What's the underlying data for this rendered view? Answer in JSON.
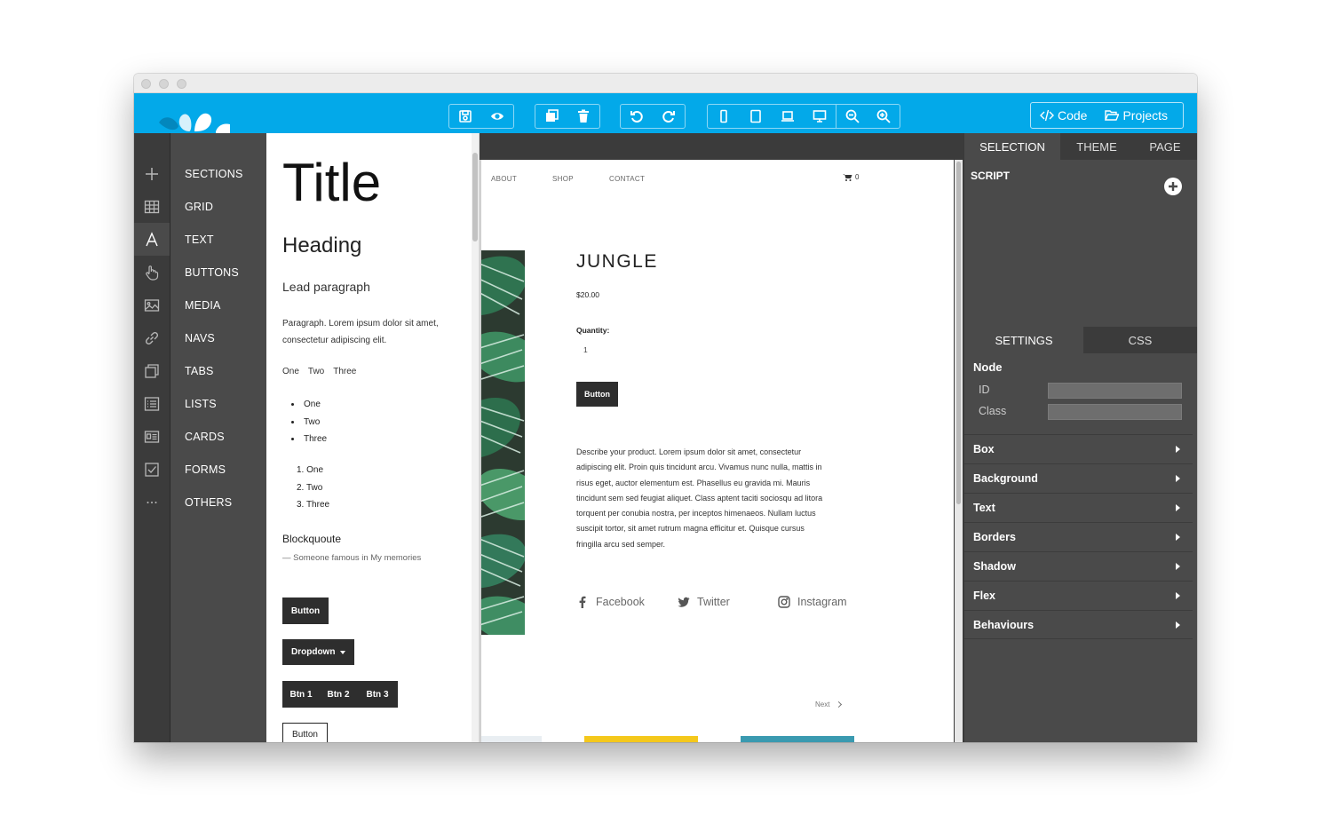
{
  "toolbar": {
    "code_label": "Code",
    "projects_label": "Projects"
  },
  "sidebar": {
    "items": [
      {
        "label": "SECTIONS",
        "icon": "plus-icon"
      },
      {
        "label": "GRID",
        "icon": "grid-icon"
      },
      {
        "label": "TEXT",
        "icon": "text-a-icon"
      },
      {
        "label": "BUTTONS",
        "icon": "pointer-hand-icon"
      },
      {
        "label": "MEDIA",
        "icon": "image-icon"
      },
      {
        "label": "NAVS",
        "icon": "link-icon"
      },
      {
        "label": "TABS",
        "icon": "tabs-icon"
      },
      {
        "label": "LISTS",
        "icon": "list-icon"
      },
      {
        "label": "CARDS",
        "icon": "card-icon"
      },
      {
        "label": "FORMS",
        "icon": "checkbox-icon"
      },
      {
        "label": "OTHERS",
        "icon": "ellipsis-icon"
      }
    ]
  },
  "blocks": {
    "title": "Title",
    "heading": "Heading",
    "lead": "Lead paragraph",
    "paragraph": "Paragraph. Lorem ipsum dolor sit amet, consectetur adipiscing elit.",
    "inline": [
      "One",
      "Two",
      "Three"
    ],
    "ulist": [
      "One",
      "Two",
      "Three"
    ],
    "olist": [
      "1. One",
      "2. Two",
      "3. Three"
    ],
    "blockquote": "Blockquoute",
    "blockquote_footer": "— Someone famous in My memories",
    "button": "Button",
    "dropdown": "Dropdown",
    "btn_group": [
      "Btn 1",
      "Btn 2",
      "Btn 3"
    ],
    "outline_button": "Button"
  },
  "canvas": {
    "nav": [
      "ABOUT",
      "SHOP",
      "CONTACT"
    ],
    "cart_count": "0",
    "product_title": "JUNGLE",
    "price": "$20.00",
    "quantity_label": "Quantity:",
    "quantity_value": "1",
    "button": "Button",
    "description": "Describe your product. Lorem ipsum dolor sit amet, consectetur adipiscing elit. Proin quis tincidunt arcu. Vivamus nunc nulla, mattis in risus eget, auctor elementum est. Phasellus eu gravida mi. Mauris tincidunt sem sed feugiat aliquet. Class aptent taciti sociosqu ad litora torquent per conubia nostra, per inceptos himenaeos. Nullam luctus suscipit tortor, sit amet rutrum magna efficitur et. Quisque cursus fringilla arcu sed semper.",
    "description_lines": [
      "Describe your product. Lorem ipsum dolor sit amet, consectetur",
      "adipiscing elit. Proin quis tincidunt arcu. Vivamus nunc nulla, mattis in",
      "risus eget, auctor elementum est. Phasellus eu gravida mi. Mauris",
      "tincidunt sem sed feugiat aliquet. Class aptent taciti sociosqu ad litora",
      "torquent per conubia nostra, per inceptos himenaeos. Nullam luctus",
      "suscipit tortor, sit amet rutrum magna efficitur et. Quisque cursus",
      "fringilla arcu sed semper."
    ],
    "social": [
      "Facebook",
      "Twitter",
      "Instagram"
    ],
    "next": "Next"
  },
  "right_panel": {
    "tabs": [
      "SELECTION",
      "THEME",
      "PAGE"
    ],
    "script_label": "SCRIPT",
    "subtabs": [
      "SETTINGS",
      "CSS"
    ],
    "node_label": "Node",
    "id_label": "ID",
    "class_label": "Class",
    "properties": [
      "Box",
      "Background",
      "Text",
      "Borders",
      "Shadow",
      "Flex",
      "Behaviours"
    ]
  },
  "colors": {
    "accent": "#03a9e9",
    "dark_panel": "#4a4a4a",
    "darker_panel": "#3b3b3b",
    "yellow": "#f4c81c",
    "teal": "#3a9ab0"
  }
}
